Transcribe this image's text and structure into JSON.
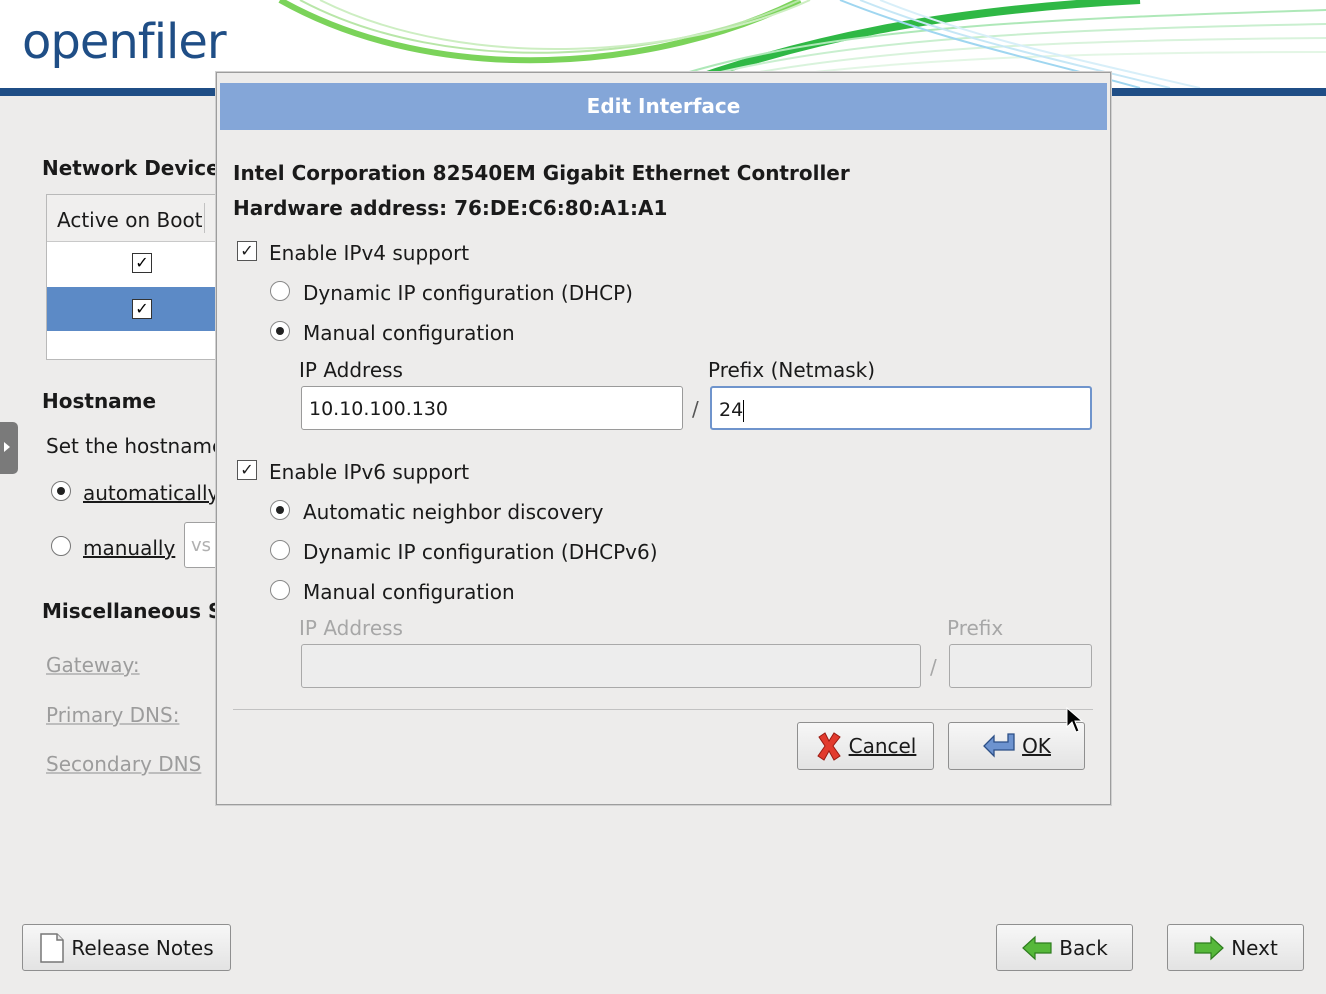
{
  "brand": {
    "logo_text": "openfiler"
  },
  "background": {
    "network_devices_heading": "Network Devices",
    "table": {
      "column_header": "Active on Boot",
      "rows": [
        {
          "active": true,
          "selected": false
        },
        {
          "active": true,
          "selected": true
        }
      ]
    },
    "hostname": {
      "heading": "Hostname",
      "description": "Set the hostname",
      "automatically_label": "automatically",
      "manually_label": "manually",
      "manual_entry_partial": "vs",
      "selected": "automatically"
    },
    "misc": {
      "heading": "Miscellaneous Settings",
      "gateway_label": "Gateway:",
      "primary_dns_label": "Primary DNS:",
      "secondary_dns_label": "Secondary DNS"
    }
  },
  "dialog": {
    "title": "Edit Interface",
    "device_name": "Intel Corporation 82540EM Gigabit Ethernet Controller",
    "hardware_address": "Hardware address: 76:DE:C6:80:A1:A1",
    "ipv4": {
      "enable_label": "Enable IPv4 support",
      "enabled": true,
      "dhcp_label": "Dynamic IP configuration (DHCP)",
      "manual_label": "Manual configuration",
      "selected": "manual",
      "ip_label": "IP Address",
      "ip_value": "10.10.100.130",
      "prefix_label": "Prefix (Netmask)",
      "prefix_value": "24",
      "separator": "/"
    },
    "ipv6": {
      "enable_label": "Enable IPv6 support",
      "enabled": true,
      "auto_label": "Automatic neighbor discovery",
      "dhcp_label": "Dynamic IP configuration (DHCPv6)",
      "manual_label": "Manual configuration",
      "selected": "auto",
      "ip_label": "IP Address",
      "ip_value": "",
      "prefix_label": "Prefix",
      "prefix_value": "",
      "separator": "/"
    },
    "buttons": {
      "cancel_label": "Cancel",
      "ok_label": "OK"
    }
  },
  "footer": {
    "release_notes_label": "Release Notes",
    "back_label": "Back",
    "next_label": "Next"
  },
  "colors": {
    "title_bar": "#84a6d8",
    "brand_blue": "#1f4e86",
    "selection": "#5c8ac6"
  },
  "icons": {
    "cancel": "red-x-icon",
    "ok": "enter-arrow-icon",
    "back": "green-left-arrow-icon",
    "next": "green-right-arrow-icon",
    "release_notes": "document-icon"
  }
}
